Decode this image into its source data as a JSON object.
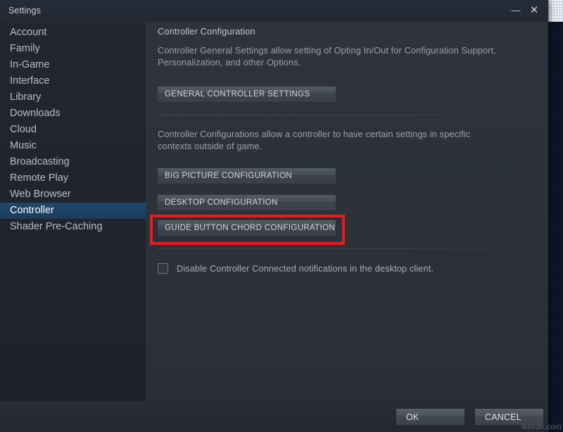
{
  "window": {
    "title": "Settings",
    "minimize_icon": "minimize-icon",
    "minimize_glyph": "—",
    "close_icon": "close-icon",
    "close_glyph": "✕"
  },
  "sidebar": {
    "items": [
      {
        "label": "Account",
        "selected": false
      },
      {
        "label": "Family",
        "selected": false
      },
      {
        "label": "In-Game",
        "selected": false
      },
      {
        "label": "Interface",
        "selected": false
      },
      {
        "label": "Library",
        "selected": false
      },
      {
        "label": "Downloads",
        "selected": false
      },
      {
        "label": "Cloud",
        "selected": false
      },
      {
        "label": "Music",
        "selected": false
      },
      {
        "label": "Broadcasting",
        "selected": false
      },
      {
        "label": "Remote Play",
        "selected": false
      },
      {
        "label": "Web Browser",
        "selected": false
      },
      {
        "label": "Controller",
        "selected": true
      },
      {
        "label": "Shader Pre-Caching",
        "selected": false
      }
    ],
    "selected_color": "#1f486c"
  },
  "content": {
    "heading": "Controller Configuration",
    "general_description": "Controller General Settings allow setting of Opting In/Out for Configuration Support, Personalization, and other Options.",
    "general_button": "GENERAL CONTROLLER SETTINGS",
    "configurations_description": "Controller Configurations allow a controller to have certain settings in specific contexts outside of game.",
    "big_picture_button": "BIG PICTURE CONFIGURATION",
    "desktop_button": "DESKTOP CONFIGURATION",
    "guide_chord_button": "GUIDE BUTTON CHORD CONFIGURATION",
    "checkbox_label": "Disable Controller Connected notifications in the desktop client.",
    "checkbox_checked": false
  },
  "annotation": {
    "highlight_color": "#f01818",
    "highlight_target": "GUIDE BUTTON CHORD CONFIGURATION"
  },
  "footer": {
    "ok_label": "OK",
    "cancel_label": "CANCEL"
  },
  "watermark": {
    "text": "wsxdn.com"
  }
}
